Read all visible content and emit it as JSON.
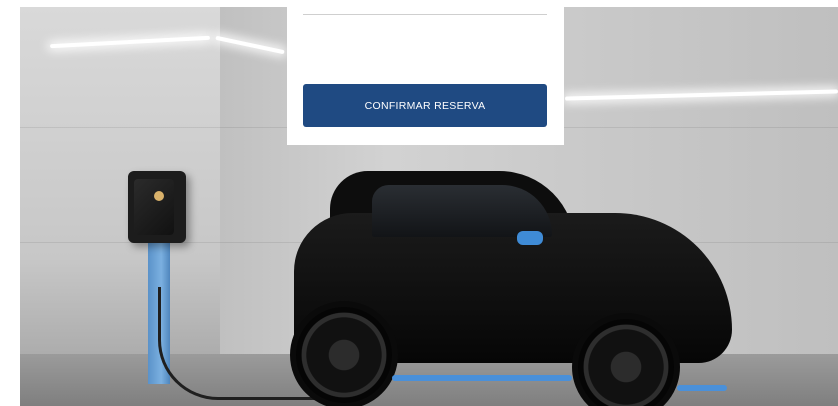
{
  "reservation": {
    "confirm_label": "CONFIRMAR RESERVA"
  },
  "hero_image": {
    "accent_color": "#4a90d9"
  },
  "colors": {
    "button": "#1f4a82",
    "card": "#ffffff"
  }
}
